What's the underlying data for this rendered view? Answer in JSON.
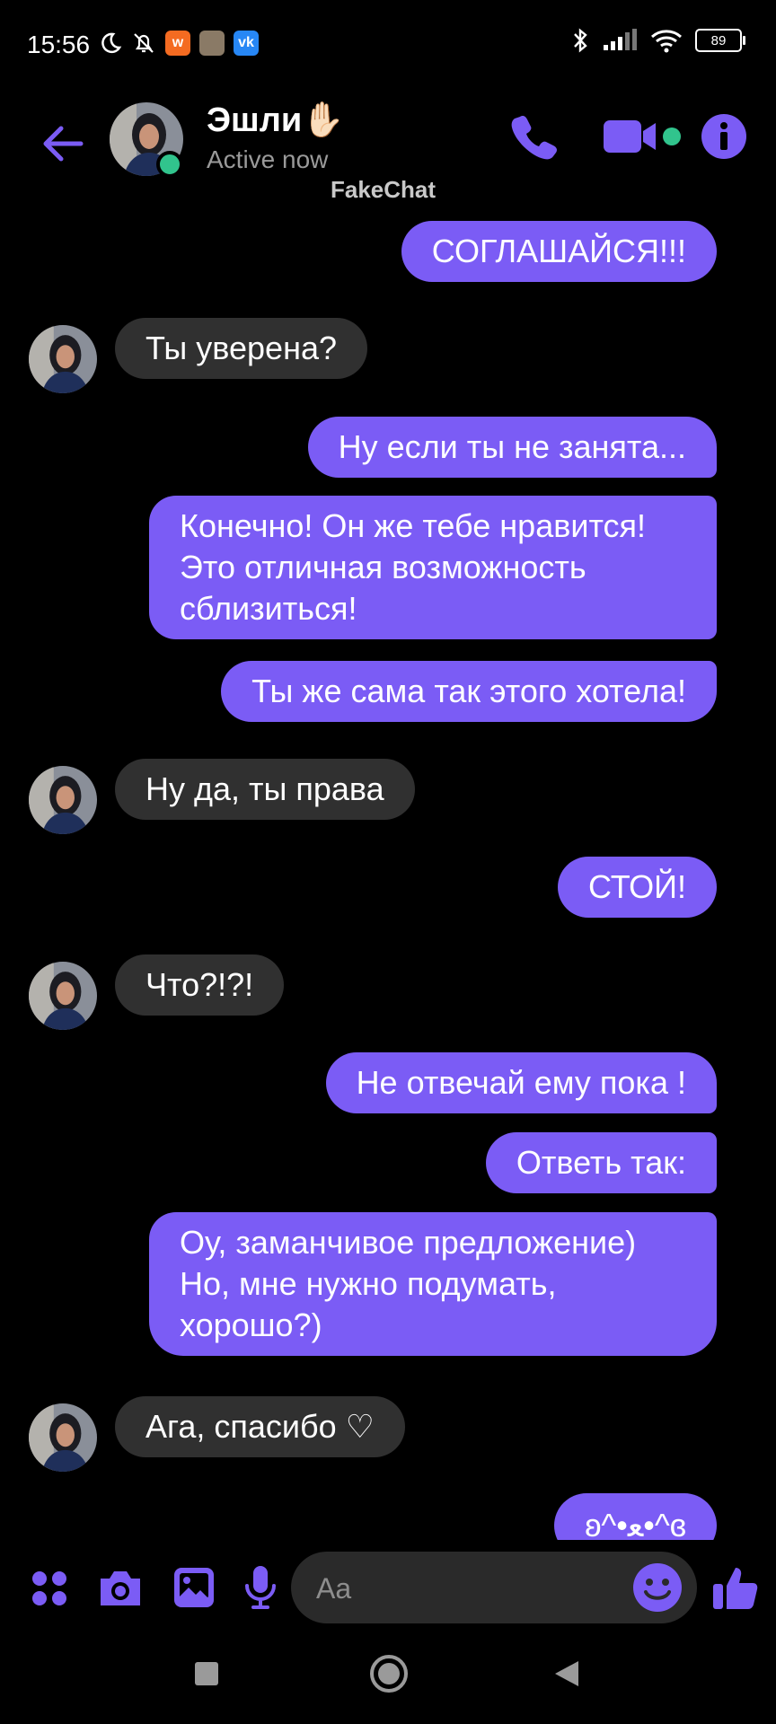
{
  "status_bar": {
    "time": "15:56",
    "app_icons": [
      {
        "name": "w-app-icon",
        "label": "w",
        "color": "#f46b21"
      },
      {
        "name": "game-app-icon",
        "label": "",
        "color": "#8a7a66"
      },
      {
        "name": "vk-app-icon",
        "label": "vk",
        "color": "#2787f5"
      }
    ],
    "battery": "89"
  },
  "header": {
    "contact_name": "Эшли✋🏻",
    "status": "Active now",
    "watermark": "FakeChat",
    "accent": "#7b5cf5",
    "online_color": "#31c48d"
  },
  "messages": [
    {
      "dir": "out",
      "text": "СОГЛАШАЙСЯ!!!"
    },
    {
      "dir": "in",
      "text": "Ты уверена?"
    },
    {
      "dir": "out",
      "text": "Ну если ты не занята..."
    },
    {
      "dir": "out",
      "text": "Конечно! Он же тебе нравится! Это отличная возможность сблизиться!"
    },
    {
      "dir": "out",
      "text": "Ты же сама так этого хотела!"
    },
    {
      "dir": "in",
      "text": "Ну да, ты права"
    },
    {
      "dir": "out",
      "text": "СТОЙ!"
    },
    {
      "dir": "in",
      "text": "Что?!?!"
    },
    {
      "dir": "out",
      "text": "Не отвечай ему пока !"
    },
    {
      "dir": "out",
      "text": "Ответь так:"
    },
    {
      "dir": "out",
      "text": "Оу, заманчивое предложение) Но, мне нужно подумать, хорошо?)"
    },
    {
      "dir": "in",
      "text": "Ага, спасибо ♡"
    },
    {
      "dir": "out",
      "text": "ʚ^•ﻌ•^ɞ"
    }
  ],
  "composer": {
    "placeholder": "Aa"
  },
  "colors": {
    "outgoing_bubble": "#7b5cf5",
    "incoming_bubble": "#303030",
    "background": "#000000"
  }
}
